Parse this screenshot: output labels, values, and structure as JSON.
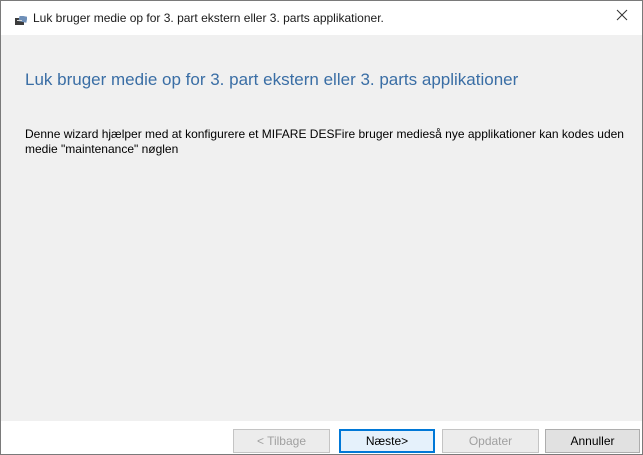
{
  "window": {
    "title": "Luk bruger medie op for 3. part ekstern eller 3. parts applikationer.",
    "app_icon": "card-reader-icon",
    "close_icon": "close-icon"
  },
  "wizard": {
    "heading": "Luk bruger medie op for 3. part ekstern eller 3. parts applikationer",
    "description": "Denne wizard hjælper med at konfigurere et MIFARE DESFire bruger medieså nye applikationer kan kodes uden medie \"maintenance\" nøglen"
  },
  "buttons": {
    "back": "< Tilbage",
    "next": "Næste>",
    "update": "Opdater",
    "cancel": "Annuller"
  },
  "colors": {
    "heading": "#3a6ea5",
    "content_background": "#f0f0f0",
    "default_button_border": "#0078d7"
  }
}
